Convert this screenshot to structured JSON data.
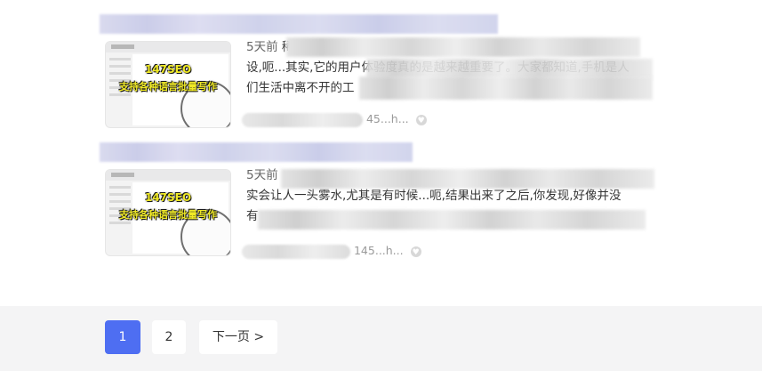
{
  "results": [
    {
      "thumbnail": {
        "title": "147SEO",
        "subtitle": "支持各种语言批量写作"
      },
      "snippet": {
        "time": "5天前",
        "line1_visible": "稀",
        "line2_visible": "设,呃...其实,它的用户体验度真的是越来越重要了。大家都知道,手机是人",
        "line3_visible": "们生活中离不开的工"
      },
      "meta": {
        "source_suffix": "45...h..."
      }
    },
    {
      "thumbnail": {
        "title": "147SEO",
        "subtitle": "支持各种语言批量写作"
      },
      "snippet": {
        "time": "5天前",
        "line1_visible": "",
        "line2_visible": "实会让人一头雾水,尤其是有时候...呃,结果出来了之后,你发现,好像并没",
        "line3_visible": "有"
      },
      "meta": {
        "source_suffix": "145...h..."
      }
    }
  ],
  "pagination": {
    "pages": [
      "1",
      "2"
    ],
    "current": "1",
    "next_label": "下一页 >",
    "accent_color": "#4e6ef2"
  }
}
